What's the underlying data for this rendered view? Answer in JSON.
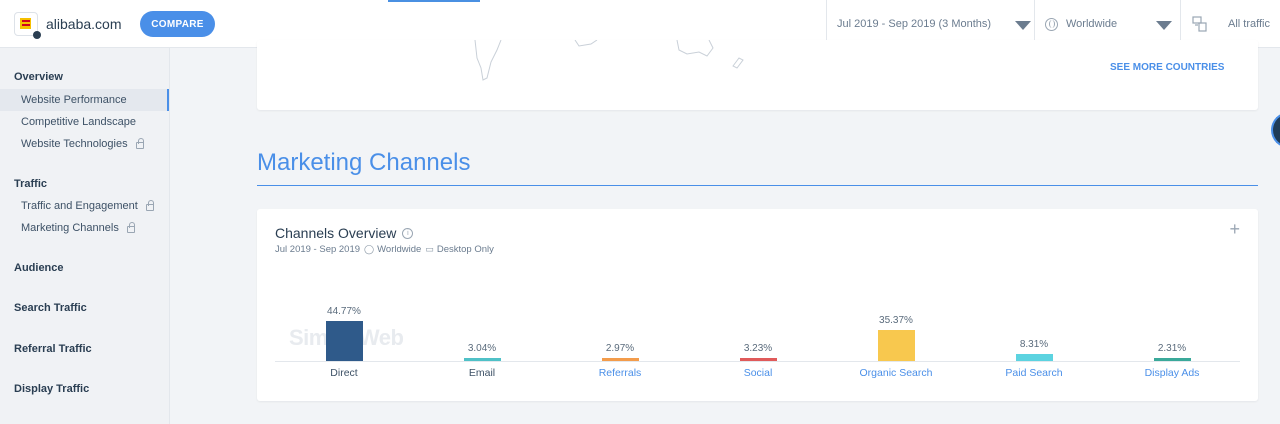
{
  "header": {
    "site_name": "alibaba.com",
    "compare_label": "COMPARE",
    "date_range": "Jul 2019 - Sep 2019 (3 Months)",
    "region": "Worldwide",
    "traffic": "All traffic"
  },
  "sidebar": {
    "sections": [
      {
        "title": "Overview",
        "items": [
          {
            "label": "Website Performance",
            "active": true,
            "locked": false
          },
          {
            "label": "Competitive Landscape",
            "active": false,
            "locked": false
          },
          {
            "label": "Website Technologies",
            "active": false,
            "locked": true
          }
        ]
      },
      {
        "title": "Traffic",
        "items": [
          {
            "label": "Traffic and Engagement",
            "active": false,
            "locked": true
          },
          {
            "label": "Marketing Channels",
            "active": false,
            "locked": true
          }
        ]
      },
      {
        "title": "Audience",
        "items": []
      },
      {
        "title": "Search Traffic",
        "items": []
      },
      {
        "title": "Referral Traffic",
        "items": []
      },
      {
        "title": "Display Traffic",
        "items": []
      }
    ]
  },
  "countries": {
    "see_more_label": "SEE MORE COUNTRIES"
  },
  "marketing": {
    "section_title": "Marketing Channels",
    "card_title": "Channels Overview",
    "date": "Jul 2019 - Sep 2019",
    "region": "Worldwide",
    "device": "Desktop Only",
    "watermark": "SimilarWeb"
  },
  "colors": {
    "accent": "#4a8fe8",
    "direct": "#2f5a8a",
    "email": "#4fc1c7",
    "referrals": "#f39c4b",
    "social": "#e05a5a",
    "organic_search": "#f8c84e",
    "paid_search": "#5cd3e0",
    "display_ads": "#3aa99a"
  },
  "chart_data": {
    "type": "bar",
    "categories": [
      "Direct",
      "Email",
      "Referrals",
      "Social",
      "Organic Search",
      "Paid Search",
      "Display Ads"
    ],
    "values": [
      44.77,
      3.04,
      2.97,
      3.23,
      35.37,
      8.31,
      2.31
    ],
    "value_labels": [
      "44.77%",
      "3.04%",
      "2.97%",
      "3.23%",
      "35.37%",
      "8.31%",
      "2.31%"
    ],
    "clickable": [
      false,
      false,
      true,
      true,
      true,
      true,
      true
    ],
    "colors": [
      "#2f5a8a",
      "#4fc1c7",
      "#f39c4b",
      "#e05a5a",
      "#f8c84e",
      "#5cd3e0",
      "#3aa99a"
    ],
    "ylim": [
      0,
      45
    ],
    "grid": false
  }
}
